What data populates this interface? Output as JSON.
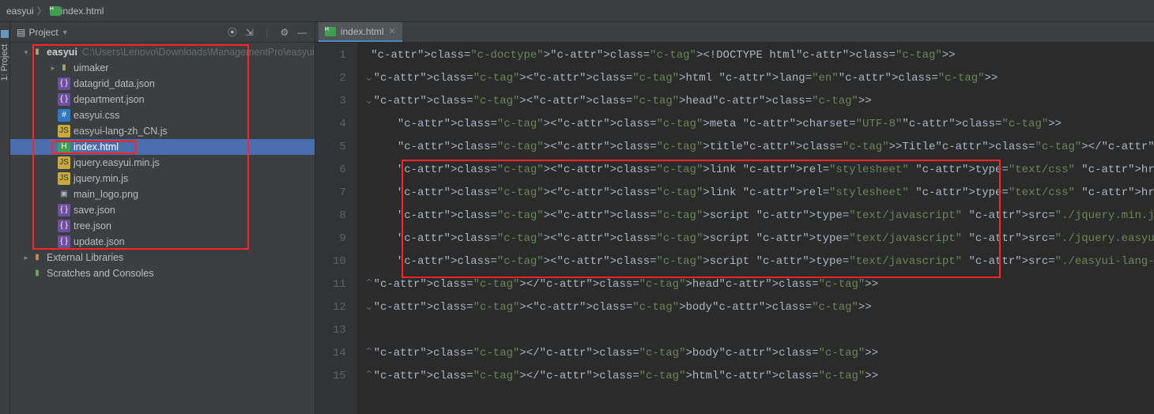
{
  "breadcrumb": {
    "project": "easyui",
    "file": "index.html"
  },
  "side_tab": {
    "label": "1: Project"
  },
  "project_panel": {
    "title": "Project",
    "root": {
      "name": "easyui",
      "path": "C:\\Users\\Lenovo\\Downloads\\ManagementPro\\easyui"
    },
    "files": [
      {
        "name": "uimaker",
        "type": "folder",
        "indent": 1,
        "expandable": true
      },
      {
        "name": "datagrid_data.json",
        "type": "json",
        "indent": 1
      },
      {
        "name": "department.json",
        "type": "json",
        "indent": 1
      },
      {
        "name": "easyui.css",
        "type": "css",
        "indent": 1
      },
      {
        "name": "easyui-lang-zh_CN.js",
        "type": "js",
        "indent": 1
      },
      {
        "name": "index.html",
        "type": "html",
        "indent": 1,
        "selected": true
      },
      {
        "name": "jquery.easyui.min.js",
        "type": "js",
        "indent": 1
      },
      {
        "name": "jquery.min.js",
        "type": "js",
        "indent": 1
      },
      {
        "name": "main_logo.png",
        "type": "png",
        "indent": 1
      },
      {
        "name": "save.json",
        "type": "json",
        "indent": 1
      },
      {
        "name": "tree.json",
        "type": "json",
        "indent": 1
      },
      {
        "name": "update.json",
        "type": "json",
        "indent": 1
      }
    ],
    "external_libs": "External Libraries",
    "scratches": "Scratches and Consoles"
  },
  "tabs": {
    "active": "index.html"
  },
  "editor": {
    "line_count": 15,
    "lines": [
      "<!DOCTYPE html>",
      "<html lang=\"en\">",
      "<head>",
      "    <meta charset=\"UTF-8\">",
      "    <title>Title</title>",
      "    <link rel=\"stylesheet\" type=\"text/css\" href=\"./uimaker/easyui.css\">",
      "    <link rel=\"stylesheet\" type=\"text/css\" href=\"./uimaker/icon.css\">",
      "    <script type=\"text/javascript\" src=\"./jquery.min.js\"></script>",
      "    <script type=\"text/javascript\" src=\"./jquery.easyui.min.js\"></script>",
      "    <script type=\"text/javascript\" src=\"./easyui-lang-zh_CN.js\"></script>",
      "</head>",
      "<body>",
      "",
      "</body>",
      "</html>"
    ]
  }
}
